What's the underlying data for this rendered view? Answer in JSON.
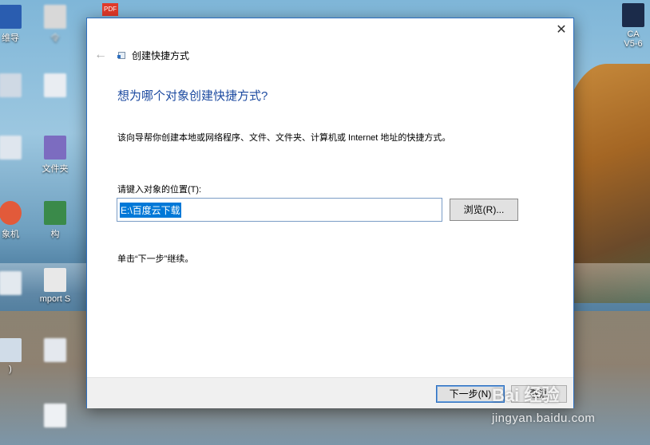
{
  "desktop": {
    "icons": [
      {
        "label": "维导",
        "color": "#2a5db0"
      },
      {
        "label": "令",
        "color": "#d8d8d8"
      },
      {
        "label": "",
        "color": "#e23a2a"
      },
      {
        "label": "文件夹",
        "color": "#7c6cc0"
      },
      {
        "label": "象机",
        "color": "#e25a3a"
      },
      {
        "label": "构",
        "color": "#3a8a4a"
      },
      {
        "label": "mport S",
        "color": "#e8e8e8"
      },
      {
        "label": ")",
        "color": "#d0dce8"
      }
    ],
    "pdf_badge": "PDF",
    "right_top_label_1": "CA",
    "right_top_label_2": "V5-6"
  },
  "dialog": {
    "close_glyph": "✕",
    "back_glyph": "←",
    "wizard_title": "创建快捷方式",
    "heading": "想为哪个对象创建快捷方式?",
    "description": "该向导帮你创建本地或网络程序、文件、文件夹、计算机或 Internet 地址的快捷方式。",
    "location_label": "请键入对象的位置(T):",
    "location_value": "E:\\百度云下载",
    "browse_button": "浏览(R)...",
    "continue_text": "单击“下一步”继续。",
    "next_button": "下一步(N)",
    "cancel_button": "取消"
  },
  "watermark": {
    "line1": "Bai 经验",
    "line2": "jingyan.baidu.com"
  },
  "colors": {
    "accent": "#2d6fbf",
    "heading": "#1c4aa0",
    "selection": "#0078d7"
  }
}
